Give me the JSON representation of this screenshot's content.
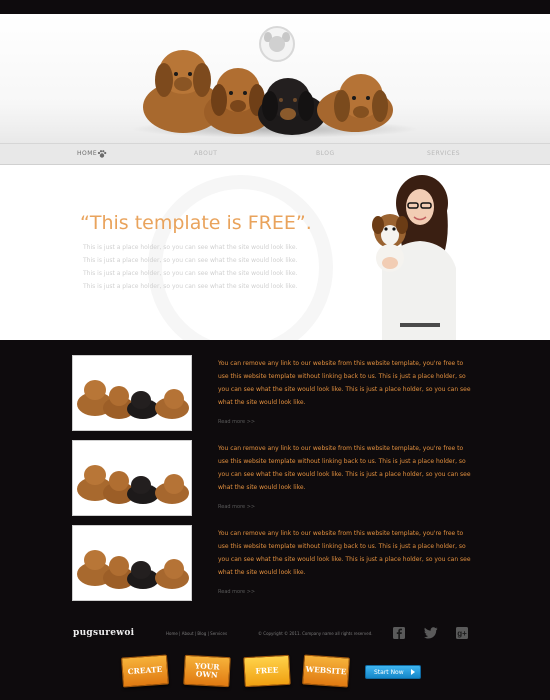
{
  "nav": {
    "items": [
      {
        "label": "HOME"
      },
      {
        "label": "ABOUT"
      },
      {
        "label": "BLOG"
      },
      {
        "label": "SERVICES"
      }
    ]
  },
  "banner": {
    "title": "“This template is FREE”.",
    "text": "This is just a place holder, so you can see what the site would look like. This is just a place holder, so you can see what the site would look like. This is just a place holder, so you can see what the site would look like. This is just a place holder, so you can see what the site would look like."
  },
  "articles": [
    {
      "text": "You can remove any link to our website from this website template, you're free to use this website template without linking back to us. This is just a place holder, so you can see what the site would look like. This is just a place holder, so you can see what the site would look like.",
      "read_more": "Read more >>"
    },
    {
      "text": "You can remove any link to our website from this website template, you're free to use this website template without linking back to us. This is just a place holder, so you can see what the site would look like. This is just a place holder, so you can see what the site would look like.",
      "read_more": "Read more >>"
    },
    {
      "text": "You can remove any link to our website from this website template, you're free to use this website template without linking back to us. This is just a place holder, so you can see what the site would look like. This is just a place holder, so you can see what the site would look like.",
      "read_more": "Read more >>"
    }
  ],
  "footer": {
    "logo": "pugsurewoi",
    "links": [
      "Home",
      "About",
      "Blog",
      "Services"
    ],
    "copyright": "© Copyright © 2011. Company name all rights reserved.",
    "social_icons": [
      "facebook-icon",
      "twitter-icon",
      "google-plus-icon"
    ],
    "promo": [
      {
        "label": "CREATE"
      },
      {
        "label": "YOUR OWN"
      },
      {
        "label": "FREE"
      },
      {
        "label": "WEBSITE"
      }
    ],
    "start_button": "Start Now"
  },
  "colors": {
    "accent_orange": "#e3903f",
    "banner_title": "#e9a35c",
    "background_dark": "#0e0b0d",
    "start_button": "#1f9ad9"
  }
}
